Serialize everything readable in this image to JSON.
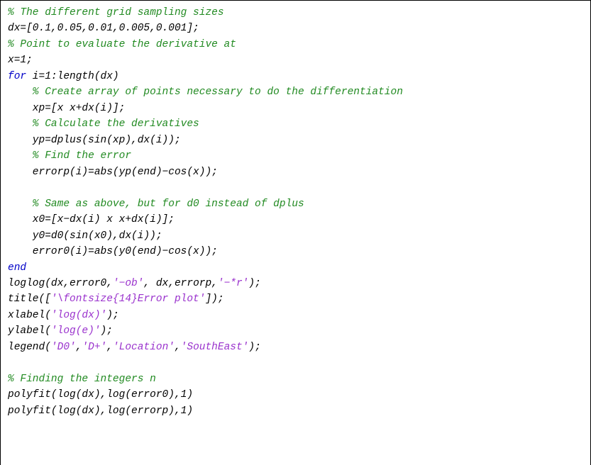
{
  "code": {
    "c1": "% The different grid sampling sizes",
    "l2": "dx=[0.1,0.05,0.01,0.005,0.001];",
    "c3": "% Point to evaluate the derivative at",
    "l4": "x=1;",
    "kw_for": "for",
    "l5b": " i=1:length(dx)",
    "c6": "    % Create array of points necessary to do the differentiation",
    "l7": "    xp=[x x+dx(i)];",
    "c8": "    % Calculate the derivatives",
    "l9": "    yp=dplus(sin(xp),dx(i));",
    "c10": "    % Find the error",
    "l11": "    errorp(i)=abs(yp(end)−cos(x));",
    "c13": "    % Same as above, but for d0 instead of dplus",
    "l14": "    x0=[x−dx(i) x x+dx(i)];",
    "l15": "    y0=d0(sin(x0),dx(i));",
    "l16": "    error0(i)=abs(y0(end)−cos(x));",
    "kw_end": "end",
    "l18a": "loglog(dx,error0,",
    "s18a": "'−ob'",
    "l18b": ", dx,errorp,",
    "s18b": "'−*r'",
    "l18c": ");",
    "l19a": "title([",
    "s19": "'\\fontsize{14}Error plot'",
    "l19b": "]);",
    "l20a": "xlabel(",
    "s20": "'log(dx)'",
    "l20b": ");",
    "l21a": "ylabel(",
    "s21": "'log(e)'",
    "l21b": ");",
    "l22a": "legend(",
    "s22a": "'D0'",
    "comma": ",",
    "s22b": "'D+'",
    "s22c": "'Location'",
    "s22d": "'SouthEast'",
    "l22b": ");",
    "c24": "% Finding the integers n",
    "l25": "polyfit(log(dx),log(error0),1)",
    "l26": "polyfit(log(dx),log(errorp),1)"
  }
}
